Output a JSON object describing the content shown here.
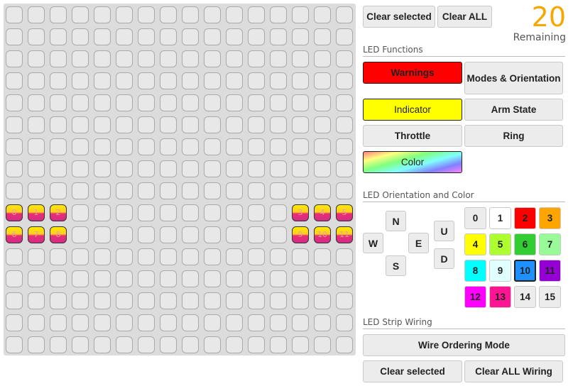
{
  "grid": {
    "rows": 16,
    "cols": 16,
    "lit_leds": [
      {
        "row": 9,
        "col": 0,
        "index": "0"
      },
      {
        "row": 9,
        "col": 1,
        "index": "1"
      },
      {
        "row": 9,
        "col": 2,
        "index": "2"
      },
      {
        "row": 9,
        "col": 13,
        "index": "3"
      },
      {
        "row": 9,
        "col": 14,
        "index": "4"
      },
      {
        "row": 9,
        "col": 15,
        "index": "5"
      },
      {
        "row": 10,
        "col": 0,
        "index": "6"
      },
      {
        "row": 10,
        "col": 1,
        "index": "7"
      },
      {
        "row": 10,
        "col": 2,
        "index": "8"
      },
      {
        "row": 10,
        "col": 13,
        "index": "9"
      },
      {
        "row": 10,
        "col": 14,
        "index": "10"
      },
      {
        "row": 10,
        "col": 15,
        "index": "11"
      }
    ]
  },
  "top_controls": {
    "clear_selected": "Clear selected",
    "clear_all": "Clear ALL",
    "remaining_count": "20",
    "remaining_label": "Remaining"
  },
  "functions": {
    "title": "LED Functions",
    "warnings": "Warnings",
    "modes": "Modes & Orientation",
    "indicator": "Indicator",
    "arm_state": "Arm State",
    "throttle": "Throttle",
    "ring": "Ring",
    "color": "Color",
    "warnings_color": "#ff0000",
    "indicator_color": "#ffff00"
  },
  "orientation": {
    "title": "LED Orientation and Color",
    "directions": {
      "n": "N",
      "w": "W",
      "e": "E",
      "s": "S",
      "u": "U",
      "d": "D"
    },
    "colors": [
      {
        "label": "0",
        "hex": "#ececec"
      },
      {
        "label": "1",
        "hex": "#ffffff"
      },
      {
        "label": "2",
        "hex": "#ff0000"
      },
      {
        "label": "3",
        "hex": "#ffa500"
      },
      {
        "label": "4",
        "hex": "#ffff00"
      },
      {
        "label": "5",
        "hex": "#adff2f"
      },
      {
        "label": "6",
        "hex": "#32cd32"
      },
      {
        "label": "7",
        "hex": "#98fb98"
      },
      {
        "label": "8",
        "hex": "#00ffff"
      },
      {
        "label": "9",
        "hex": "#e0ffff"
      },
      {
        "label": "10",
        "hex": "#1e90ff",
        "selected": true
      },
      {
        "label": "11",
        "hex": "#9400d3"
      },
      {
        "label": "12",
        "hex": "#ff00ff"
      },
      {
        "label": "13",
        "hex": "#ff1493"
      },
      {
        "label": "14",
        "hex": "#ececec"
      },
      {
        "label": "15",
        "hex": "#ececec"
      }
    ]
  },
  "wiring": {
    "title": "LED Strip Wiring",
    "wire_ordering": "Wire Ordering Mode",
    "clear_selected": "Clear selected",
    "clear_all": "Clear ALL Wiring"
  }
}
